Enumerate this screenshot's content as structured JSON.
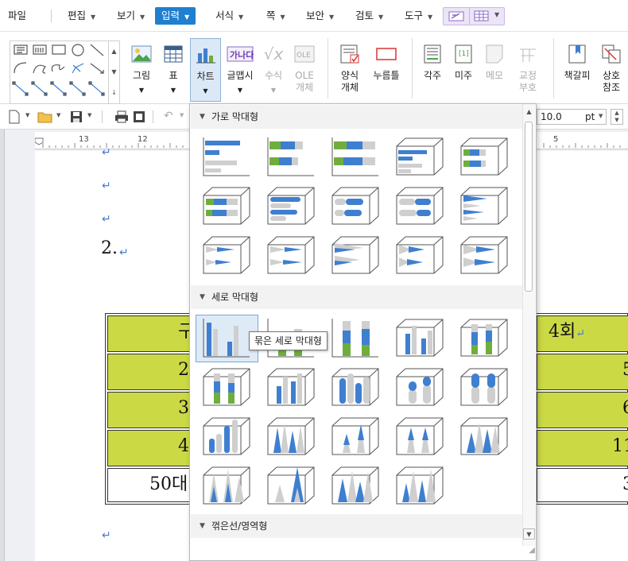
{
  "menubar": {
    "items": [
      "파일",
      "편집",
      "보기",
      "입력",
      "서식",
      "쪽",
      "보안",
      "검토",
      "도구"
    ]
  },
  "ribbon": {
    "buttons": [
      "그림",
      "표",
      "차트",
      "글맵시",
      "수식",
      "OLE\n개체",
      "양식\n개체",
      "누름틀",
      "각주",
      "미주",
      "메모",
      "교정\n부호",
      "책갈피",
      "상호\n참조"
    ]
  },
  "toolbar": {
    "font_size": "10.0",
    "unit": "pt"
  },
  "ruler": {
    "marks": [
      "13",
      "12",
      "5"
    ]
  },
  "document": {
    "para_mark": "↵",
    "numbered_line": "2.",
    "table": {
      "rows": [
        [
          "구",
          "4회"
        ],
        [
          "2",
          "5"
        ],
        [
          "3",
          "6"
        ],
        [
          "4",
          "11"
        ],
        [
          "50대",
          "3"
        ]
      ]
    }
  },
  "dropdown": {
    "sections": [
      "가로 막대형",
      "세로 막대형",
      "꺾은선/영역형"
    ],
    "tooltip": "묶은 세로 막대형"
  },
  "colors": {
    "accent": "#1f7fd0",
    "table_fill": "#cbd945",
    "chart_blue": "#3f7fd0",
    "chart_green": "#6fae3c",
    "chart_gray": "#cfcfcf"
  }
}
